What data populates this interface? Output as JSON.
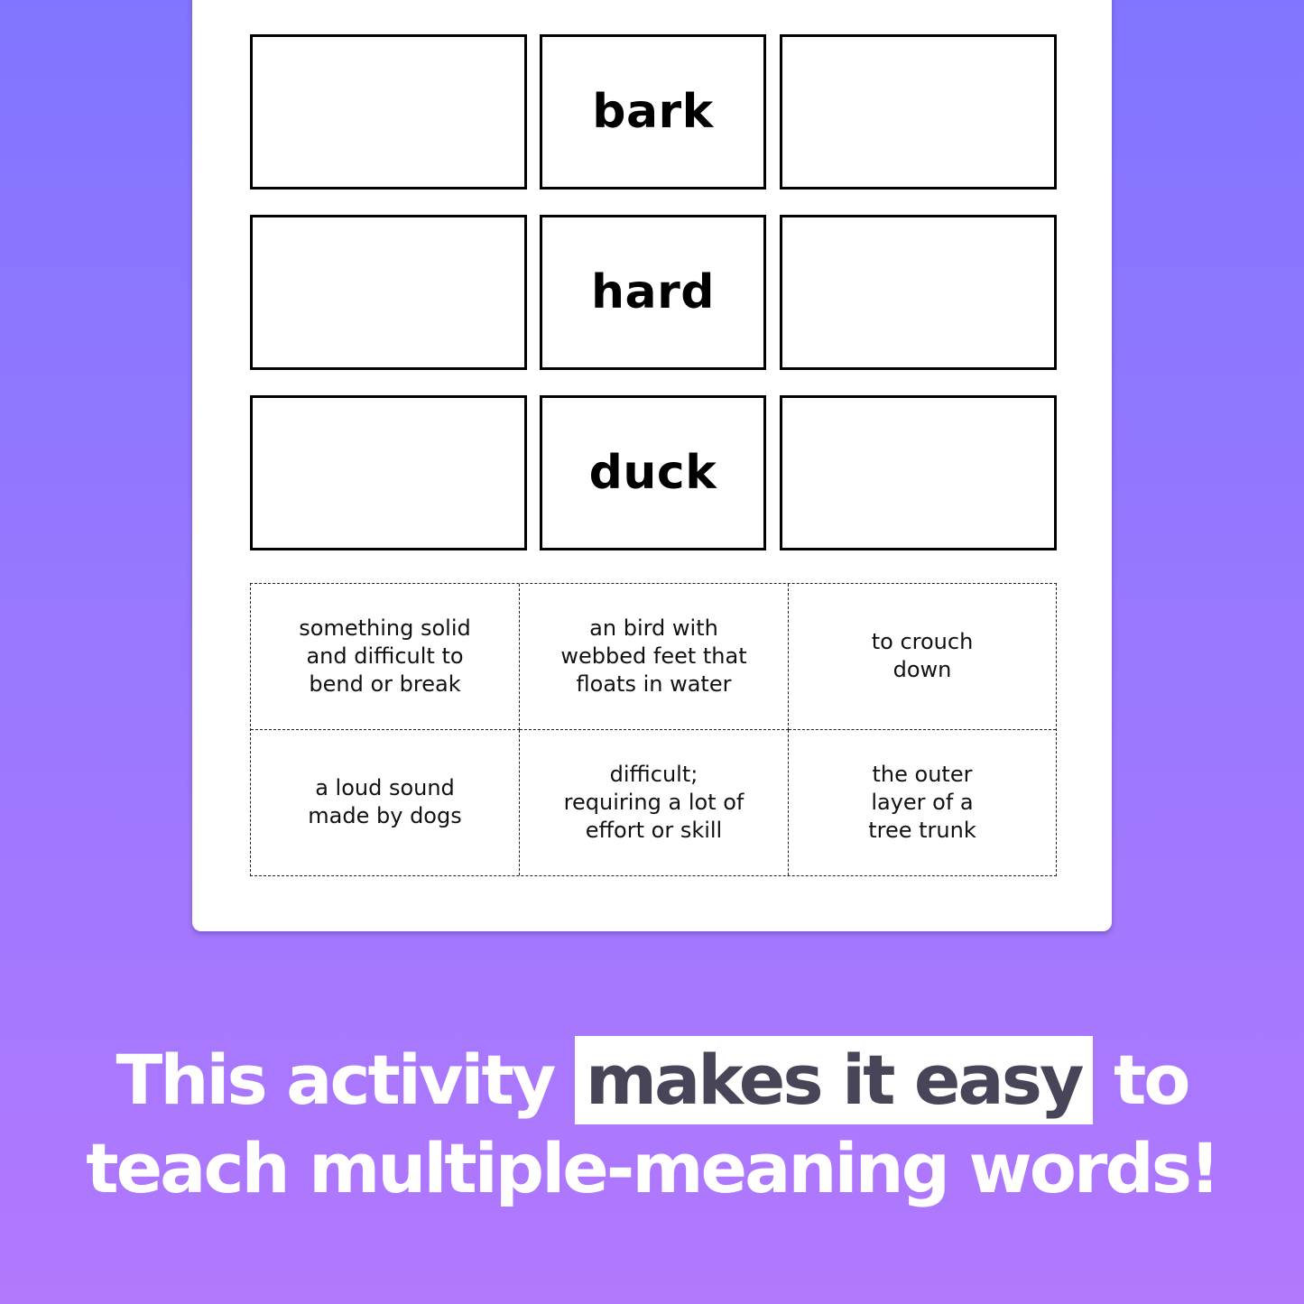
{
  "worksheet": {
    "rows": [
      {
        "left_blank": "",
        "word": "bark",
        "right_blank": ""
      },
      {
        "left_blank": "",
        "word": "hard",
        "right_blank": ""
      },
      {
        "left_blank": "",
        "word": "duck",
        "right_blank": ""
      }
    ],
    "definition_cards": [
      "something solid\nand difficult to\nbend or break",
      "an bird with\nwebbed feet that\nfloats in water",
      "to crouch\ndown",
      "a loud sound\nmade by dogs",
      "difficult;\nrequiring a lot of\neffort or skill",
      "the outer\nlayer of a\ntree trunk"
    ]
  },
  "caption": {
    "line1_before": "This activity",
    "line1_highlight": "makes it easy",
    "line1_after": "to",
    "line2": "teach multiple-meaning words!"
  },
  "colors": {
    "background_top": "#8175ff",
    "background_bottom": "#b278fe",
    "highlight_bg": "#ffffff",
    "highlight_text": "#484558",
    "caption_text": "#ffffff"
  }
}
